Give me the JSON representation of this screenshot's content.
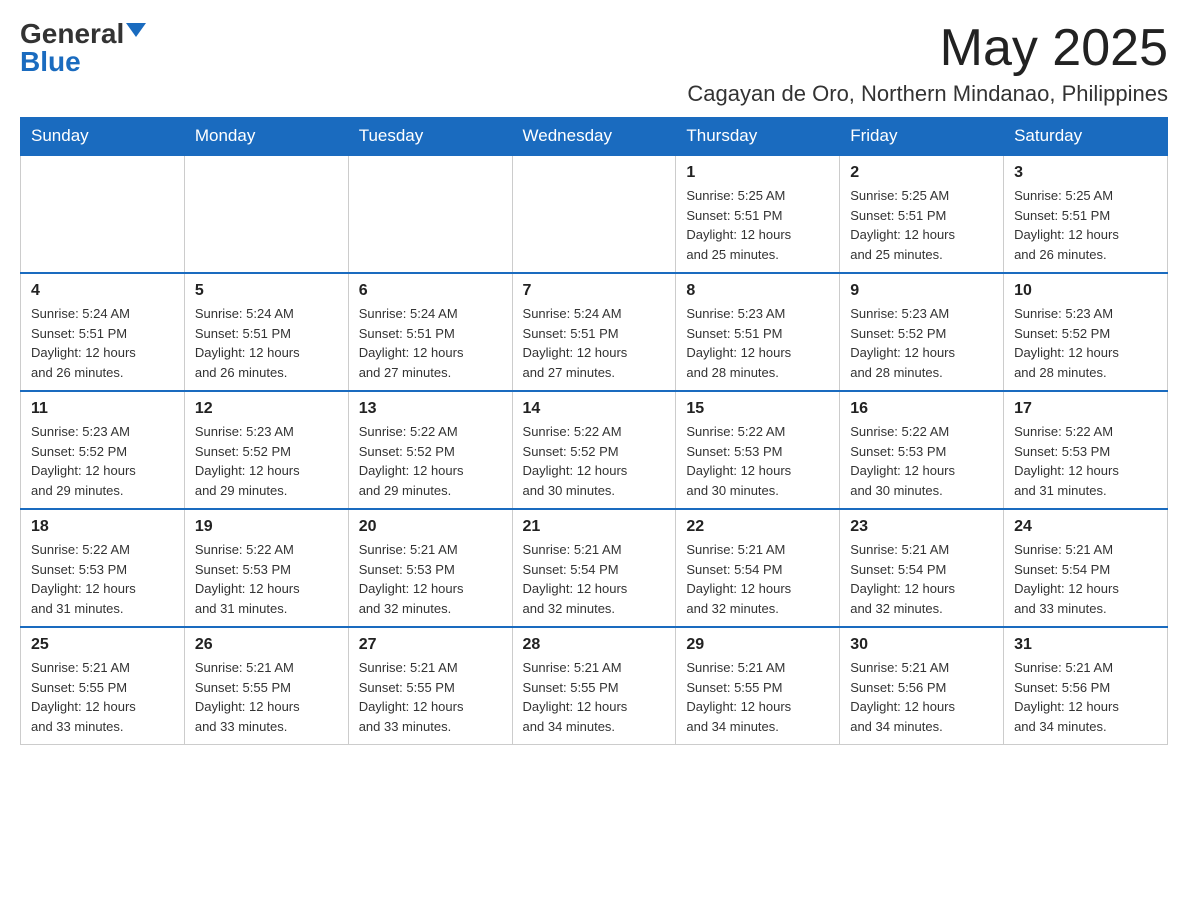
{
  "header": {
    "logo_general": "General",
    "logo_blue": "Blue",
    "month_title": "May 2025",
    "subtitle": "Cagayan de Oro, Northern Mindanao, Philippines"
  },
  "days_of_week": [
    "Sunday",
    "Monday",
    "Tuesday",
    "Wednesday",
    "Thursday",
    "Friday",
    "Saturday"
  ],
  "weeks": [
    [
      {
        "day": "",
        "info": ""
      },
      {
        "day": "",
        "info": ""
      },
      {
        "day": "",
        "info": ""
      },
      {
        "day": "",
        "info": ""
      },
      {
        "day": "1",
        "info": "Sunrise: 5:25 AM\nSunset: 5:51 PM\nDaylight: 12 hours\nand 25 minutes."
      },
      {
        "day": "2",
        "info": "Sunrise: 5:25 AM\nSunset: 5:51 PM\nDaylight: 12 hours\nand 25 minutes."
      },
      {
        "day": "3",
        "info": "Sunrise: 5:25 AM\nSunset: 5:51 PM\nDaylight: 12 hours\nand 26 minutes."
      }
    ],
    [
      {
        "day": "4",
        "info": "Sunrise: 5:24 AM\nSunset: 5:51 PM\nDaylight: 12 hours\nand 26 minutes."
      },
      {
        "day": "5",
        "info": "Sunrise: 5:24 AM\nSunset: 5:51 PM\nDaylight: 12 hours\nand 26 minutes."
      },
      {
        "day": "6",
        "info": "Sunrise: 5:24 AM\nSunset: 5:51 PM\nDaylight: 12 hours\nand 27 minutes."
      },
      {
        "day": "7",
        "info": "Sunrise: 5:24 AM\nSunset: 5:51 PM\nDaylight: 12 hours\nand 27 minutes."
      },
      {
        "day": "8",
        "info": "Sunrise: 5:23 AM\nSunset: 5:51 PM\nDaylight: 12 hours\nand 28 minutes."
      },
      {
        "day": "9",
        "info": "Sunrise: 5:23 AM\nSunset: 5:52 PM\nDaylight: 12 hours\nand 28 minutes."
      },
      {
        "day": "10",
        "info": "Sunrise: 5:23 AM\nSunset: 5:52 PM\nDaylight: 12 hours\nand 28 minutes."
      }
    ],
    [
      {
        "day": "11",
        "info": "Sunrise: 5:23 AM\nSunset: 5:52 PM\nDaylight: 12 hours\nand 29 minutes."
      },
      {
        "day": "12",
        "info": "Sunrise: 5:23 AM\nSunset: 5:52 PM\nDaylight: 12 hours\nand 29 minutes."
      },
      {
        "day": "13",
        "info": "Sunrise: 5:22 AM\nSunset: 5:52 PM\nDaylight: 12 hours\nand 29 minutes."
      },
      {
        "day": "14",
        "info": "Sunrise: 5:22 AM\nSunset: 5:52 PM\nDaylight: 12 hours\nand 30 minutes."
      },
      {
        "day": "15",
        "info": "Sunrise: 5:22 AM\nSunset: 5:53 PM\nDaylight: 12 hours\nand 30 minutes."
      },
      {
        "day": "16",
        "info": "Sunrise: 5:22 AM\nSunset: 5:53 PM\nDaylight: 12 hours\nand 30 minutes."
      },
      {
        "day": "17",
        "info": "Sunrise: 5:22 AM\nSunset: 5:53 PM\nDaylight: 12 hours\nand 31 minutes."
      }
    ],
    [
      {
        "day": "18",
        "info": "Sunrise: 5:22 AM\nSunset: 5:53 PM\nDaylight: 12 hours\nand 31 minutes."
      },
      {
        "day": "19",
        "info": "Sunrise: 5:22 AM\nSunset: 5:53 PM\nDaylight: 12 hours\nand 31 minutes."
      },
      {
        "day": "20",
        "info": "Sunrise: 5:21 AM\nSunset: 5:53 PM\nDaylight: 12 hours\nand 32 minutes."
      },
      {
        "day": "21",
        "info": "Sunrise: 5:21 AM\nSunset: 5:54 PM\nDaylight: 12 hours\nand 32 minutes."
      },
      {
        "day": "22",
        "info": "Sunrise: 5:21 AM\nSunset: 5:54 PM\nDaylight: 12 hours\nand 32 minutes."
      },
      {
        "day": "23",
        "info": "Sunrise: 5:21 AM\nSunset: 5:54 PM\nDaylight: 12 hours\nand 32 minutes."
      },
      {
        "day": "24",
        "info": "Sunrise: 5:21 AM\nSunset: 5:54 PM\nDaylight: 12 hours\nand 33 minutes."
      }
    ],
    [
      {
        "day": "25",
        "info": "Sunrise: 5:21 AM\nSunset: 5:55 PM\nDaylight: 12 hours\nand 33 minutes."
      },
      {
        "day": "26",
        "info": "Sunrise: 5:21 AM\nSunset: 5:55 PM\nDaylight: 12 hours\nand 33 minutes."
      },
      {
        "day": "27",
        "info": "Sunrise: 5:21 AM\nSunset: 5:55 PM\nDaylight: 12 hours\nand 33 minutes."
      },
      {
        "day": "28",
        "info": "Sunrise: 5:21 AM\nSunset: 5:55 PM\nDaylight: 12 hours\nand 34 minutes."
      },
      {
        "day": "29",
        "info": "Sunrise: 5:21 AM\nSunset: 5:55 PM\nDaylight: 12 hours\nand 34 minutes."
      },
      {
        "day": "30",
        "info": "Sunrise: 5:21 AM\nSunset: 5:56 PM\nDaylight: 12 hours\nand 34 minutes."
      },
      {
        "day": "31",
        "info": "Sunrise: 5:21 AM\nSunset: 5:56 PM\nDaylight: 12 hours\nand 34 minutes."
      }
    ]
  ]
}
